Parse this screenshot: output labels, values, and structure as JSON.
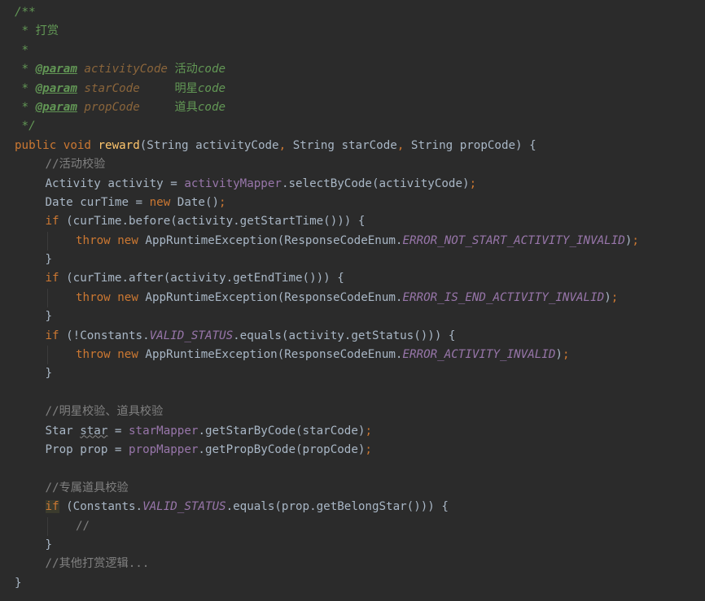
{
  "editor": {
    "lines": [
      {
        "indent": 0,
        "tokens": [
          {
            "c": "doc",
            "t": "/**"
          }
        ]
      },
      {
        "indent": 0,
        "tokens": [
          {
            "c": "doc",
            "t": " * "
          },
          {
            "c": "doc-cjk",
            "t": "打赏"
          }
        ]
      },
      {
        "indent": 0,
        "tokens": [
          {
            "c": "doc",
            "t": " *"
          }
        ]
      },
      {
        "indent": 0,
        "tokens": [
          {
            "c": "doc",
            "t": " * "
          },
          {
            "c": "doc-tag",
            "t": "@param"
          },
          {
            "c": "doc",
            "t": " "
          },
          {
            "c": "doc-param",
            "t": "activityCode"
          },
          {
            "c": "doc",
            "t": " "
          },
          {
            "c": "doc-cjk",
            "t": "活动"
          },
          {
            "c": "doc",
            "t": "code"
          }
        ]
      },
      {
        "indent": 0,
        "tokens": [
          {
            "c": "doc",
            "t": " * "
          },
          {
            "c": "doc-tag",
            "t": "@param"
          },
          {
            "c": "doc",
            "t": " "
          },
          {
            "c": "doc-param",
            "t": "starCode"
          },
          {
            "c": "doc",
            "t": "     "
          },
          {
            "c": "doc-cjk",
            "t": "明星"
          },
          {
            "c": "doc",
            "t": "code"
          }
        ]
      },
      {
        "indent": 0,
        "tokens": [
          {
            "c": "doc",
            "t": " * "
          },
          {
            "c": "doc-tag",
            "t": "@param"
          },
          {
            "c": "doc",
            "t": " "
          },
          {
            "c": "doc-param",
            "t": "propCode"
          },
          {
            "c": "doc",
            "t": "     "
          },
          {
            "c": "doc-cjk",
            "t": "道具"
          },
          {
            "c": "doc",
            "t": "code"
          }
        ]
      },
      {
        "indent": 0,
        "tokens": [
          {
            "c": "doc",
            "t": " */"
          }
        ]
      },
      {
        "indent": 0,
        "tokens": [
          {
            "c": "kw",
            "t": "public void "
          },
          {
            "c": "fn",
            "t": "reward"
          },
          {
            "c": "pl",
            "t": "(String activityCode"
          },
          {
            "c": "kw",
            "t": ", "
          },
          {
            "c": "pl",
            "t": "String starCode"
          },
          {
            "c": "kw",
            "t": ", "
          },
          {
            "c": "pl",
            "t": "String propCode) {"
          }
        ]
      },
      {
        "indent": 1,
        "tokens": [
          {
            "c": "cmt",
            "t": "//活动校验"
          }
        ]
      },
      {
        "indent": 1,
        "tokens": [
          {
            "c": "pl",
            "t": "Activity activity = "
          },
          {
            "c": "fld",
            "t": "activityMapper"
          },
          {
            "c": "pl",
            "t": ".selectByCode(activityCode)"
          },
          {
            "c": "kw",
            "t": ";"
          }
        ]
      },
      {
        "indent": 1,
        "tokens": [
          {
            "c": "pl",
            "t": "Date curTime = "
          },
          {
            "c": "kw",
            "t": "new "
          },
          {
            "c": "pl",
            "t": "Date()"
          },
          {
            "c": "kw",
            "t": ";"
          }
        ]
      },
      {
        "indent": 1,
        "tokens": [
          {
            "c": "kw",
            "t": "if "
          },
          {
            "c": "pl",
            "t": "(curTime.before(activity.getStartTime())) {"
          }
        ]
      },
      {
        "indent": 2,
        "tokens": [
          {
            "c": "kw",
            "t": "throw new "
          },
          {
            "c": "pl",
            "t": "AppRuntimeException(ResponseCodeEnum."
          },
          {
            "c": "sfld",
            "t": "ERROR_NOT_START_ACTIVITY_INVALID"
          },
          {
            "c": "pl",
            "t": ")"
          },
          {
            "c": "kw",
            "t": ";"
          }
        ]
      },
      {
        "indent": 1,
        "tokens": [
          {
            "c": "pl",
            "t": "}"
          }
        ]
      },
      {
        "indent": 1,
        "tokens": [
          {
            "c": "kw",
            "t": "if "
          },
          {
            "c": "pl",
            "t": "(curTime.after(activity.getEndTime())) {"
          }
        ]
      },
      {
        "indent": 2,
        "tokens": [
          {
            "c": "kw",
            "t": "throw new "
          },
          {
            "c": "pl",
            "t": "AppRuntimeException(ResponseCodeEnum."
          },
          {
            "c": "sfld",
            "t": "ERROR_IS_END_ACTIVITY_INVALID"
          },
          {
            "c": "pl",
            "t": ")"
          },
          {
            "c": "kw",
            "t": ";"
          }
        ]
      },
      {
        "indent": 1,
        "tokens": [
          {
            "c": "pl",
            "t": "}"
          }
        ]
      },
      {
        "indent": 1,
        "tokens": [
          {
            "c": "kw",
            "t": "if "
          },
          {
            "c": "pl",
            "t": "(!Constants."
          },
          {
            "c": "sfld",
            "t": "VALID_STATUS"
          },
          {
            "c": "pl",
            "t": ".equals(activity.getStatus())) {"
          }
        ]
      },
      {
        "indent": 2,
        "tokens": [
          {
            "c": "kw",
            "t": "throw new "
          },
          {
            "c": "pl",
            "t": "AppRuntimeException(ResponseCodeEnum."
          },
          {
            "c": "sfld",
            "t": "ERROR_ACTIVITY_INVALID"
          },
          {
            "c": "pl",
            "t": ")"
          },
          {
            "c": "kw",
            "t": ";"
          }
        ]
      },
      {
        "indent": 1,
        "tokens": [
          {
            "c": "pl",
            "t": "}"
          }
        ]
      },
      {
        "indent": 0,
        "tokens": []
      },
      {
        "indent": 1,
        "tokens": [
          {
            "c": "cmt",
            "t": "//明星校验、道具校验"
          }
        ]
      },
      {
        "indent": 1,
        "tokens": [
          {
            "c": "pl",
            "t": "Star "
          },
          {
            "c": "pl warn",
            "t": "star"
          },
          {
            "c": "pl",
            "t": " = "
          },
          {
            "c": "fld",
            "t": "starMapper"
          },
          {
            "c": "pl",
            "t": ".getStarByCode(starCode)"
          },
          {
            "c": "kw",
            "t": ";"
          }
        ]
      },
      {
        "indent": 1,
        "tokens": [
          {
            "c": "pl",
            "t": "Prop prop = "
          },
          {
            "c": "fld",
            "t": "propMapper"
          },
          {
            "c": "pl",
            "t": ".getPropByCode(propCode)"
          },
          {
            "c": "kw",
            "t": ";"
          }
        ]
      },
      {
        "indent": 0,
        "tokens": []
      },
      {
        "indent": 1,
        "tokens": [
          {
            "c": "cmt",
            "t": "//专属道具校验"
          }
        ]
      },
      {
        "indent": 1,
        "tokens": [
          {
            "c": "kw kw-hl",
            "t": "if"
          },
          {
            "c": "pl",
            "t": " (Constants."
          },
          {
            "c": "sfld",
            "t": "VALID_STATUS"
          },
          {
            "c": "pl",
            "t": ".equals(prop.getBelongStar())) {"
          }
        ]
      },
      {
        "indent": 2,
        "tokens": [
          {
            "c": "cmt",
            "t": "//"
          }
        ]
      },
      {
        "indent": 1,
        "tokens": [
          {
            "c": "pl",
            "t": "}"
          }
        ]
      },
      {
        "indent": 1,
        "tokens": [
          {
            "c": "cmt",
            "t": "//其他打赏逻辑..."
          }
        ]
      },
      {
        "indent": 0,
        "tokens": [
          {
            "c": "pl",
            "t": "}"
          }
        ]
      }
    ]
  }
}
